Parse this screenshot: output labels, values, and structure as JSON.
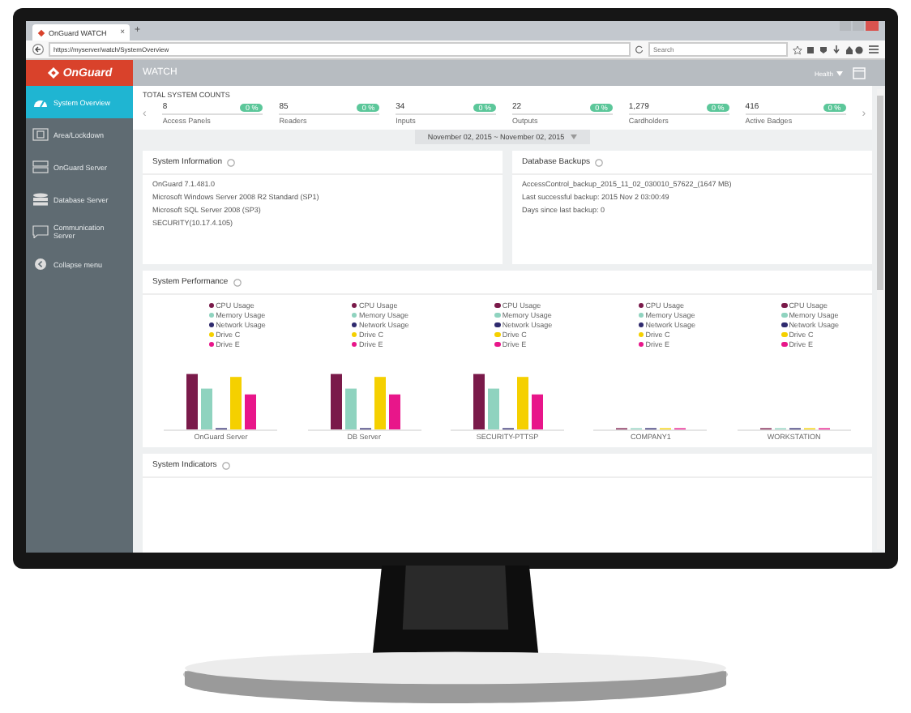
{
  "browser": {
    "tab_title": "OnGuard WATCH",
    "tab_close": "×",
    "new_tab": "+",
    "url": "https://myserver/watch/SystemOverview",
    "search": {
      "placeholder": "Search"
    }
  },
  "brand": "OnGuard",
  "app_title": "WATCH",
  "header_menu": "Health",
  "sidebar": {
    "items": [
      {
        "label": "System Overview",
        "selected": true
      },
      {
        "label": "Area/Lockdown",
        "selected": false
      },
      {
        "label": "OnGuard Server",
        "selected": false
      },
      {
        "label": "Database Server",
        "selected": false
      },
      {
        "label": "Communication Server",
        "selected": false
      },
      {
        "label": "Collapse menu",
        "selected": false
      }
    ]
  },
  "counts": {
    "title": "TOTAL SYSTEM COUNTS",
    "prev": "‹",
    "next": "›",
    "items": [
      {
        "value": "8",
        "badge": "0 %",
        "label": "Access Panels"
      },
      {
        "value": "85",
        "badge": "0 %",
        "label": "Readers"
      },
      {
        "value": "34",
        "badge": "0 %",
        "label": "Inputs"
      },
      {
        "value": "22",
        "badge": "0 %",
        "label": "Outputs"
      },
      {
        "value": "1,279",
        "badge": "0 %",
        "label": "Cardholders"
      },
      {
        "value": "416",
        "badge": "0 %",
        "label": "Active Badges"
      }
    ]
  },
  "date_range": {
    "from": "November 02, 2015",
    "separator": "~",
    "to": "November 02, 2015"
  },
  "system_information": {
    "title": "System Information",
    "lines": [
      "OnGuard 7.1.481.0",
      "Microsoft Windows Server 2008 R2 Standard (SP1)",
      "Microsoft SQL Server 2008 (SP3)",
      "SECURITY(10.17.4.105)"
    ]
  },
  "database_backups": {
    "title": "Database Backups",
    "lines": [
      "AccessControl_backup_2015_11_02_030010_57622_(1647 MB)",
      "Last successful backup: 2015 Nov 2 03:00:49",
      "Days since last backup: 0"
    ]
  },
  "system_performance": {
    "title": "System Performance",
    "servers": [
      {
        "name": "OnGuard Server",
        "legend": [
          {
            "label": "CPU Usage",
            "color": "#7a1a4a"
          },
          {
            "label": "Memory Usage",
            "color": "#8fd3bf"
          },
          {
            "label": "Network Usage",
            "color": "#2e2a6e"
          },
          {
            "label": "Drive C",
            "color": "#f5d000"
          },
          {
            "label": "Drive E",
            "color": "#e8168a"
          }
        ]
      },
      {
        "name": "DB Server",
        "legend": [
          {
            "label": "CPU Usage",
            "color": "#7a1a4a"
          },
          {
            "label": "Memory Usage",
            "color": "#8fd3bf"
          },
          {
            "label": "Network Usage",
            "color": "#2e2a6e"
          },
          {
            "label": "Drive C",
            "color": "#f5d000"
          },
          {
            "label": "Drive E",
            "color": "#e8168a"
          }
        ]
      },
      {
        "name": "SECURITY-PTTSP",
        "legend": [
          {
            "label": "CPU Usage",
            "color": "#7a1a4a"
          },
          {
            "label": "Memory Usage",
            "color": "#8fd3bf"
          },
          {
            "label": "Network Usage",
            "color": "#2e2a6e"
          },
          {
            "label": "Drive C",
            "color": "#f5d000"
          },
          {
            "label": "Drive E",
            "color": "#e8168a"
          }
        ]
      },
      {
        "name": "COMPANY1",
        "legend": [
          {
            "label": "CPU Usage",
            "color": "#7a1a4a"
          },
          {
            "label": "Memory Usage",
            "color": "#8fd3bf"
          },
          {
            "label": "Network Usage",
            "color": "#2e2a6e"
          },
          {
            "label": "Drive C",
            "color": "#f5d000"
          },
          {
            "label": "Drive E",
            "color": "#e8168a"
          }
        ]
      },
      {
        "name": "WORKSTATION",
        "legend": [
          {
            "label": "CPU Usage",
            "color": "#7a1a4a"
          },
          {
            "label": "Memory Usage",
            "color": "#8fd3bf"
          },
          {
            "label": "Network Usage",
            "color": "#2e2a6e"
          },
          {
            "label": "Drive C",
            "color": "#f5d000"
          },
          {
            "label": "Drive E",
            "color": "#e8168a"
          }
        ]
      }
    ]
  },
  "system_indicators": {
    "title": "System Indicators"
  }
}
